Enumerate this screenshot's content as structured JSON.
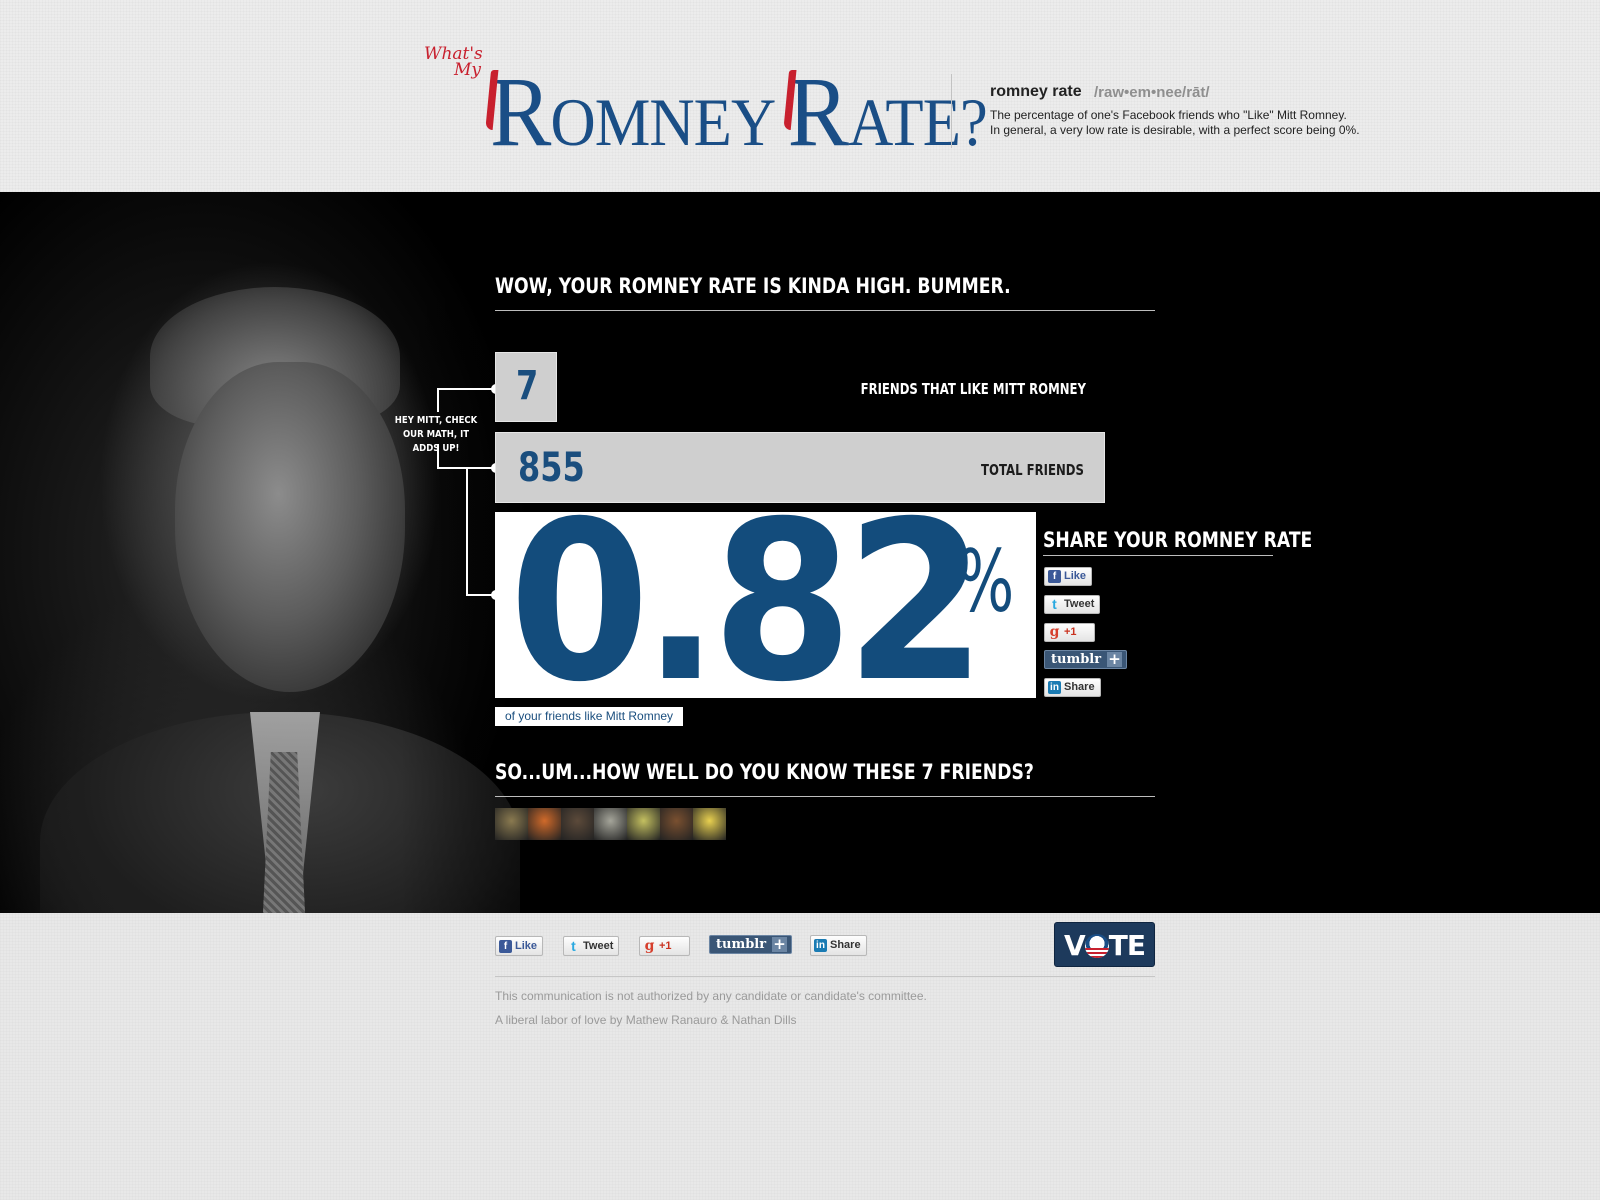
{
  "header": {
    "logo_whats": "What's",
    "logo_my": "My",
    "logo_r1": "R",
    "logo_word1": "OMNEY",
    "logo_r2": "R",
    "logo_word2": "ATE?",
    "definition_term": "romney rate",
    "definition_pronunciation": "/raw•em•nee/rāt/",
    "definition_line1": "The percentage of one's Facebook friends who \"Like\" Mitt Romney.",
    "definition_line2": "In general, a very low rate is desirable, with a perfect score being 0%."
  },
  "result": {
    "headline": "WOW, YOUR ROMNEY RATE IS KINDA HIGH. BUMMER.",
    "liking_friends_count": "7",
    "liking_friends_label": "FRIENDS THAT LIKE MITT ROMNEY",
    "total_friends_count": "855",
    "total_friends_label": "TOTAL FRIENDS",
    "bracket_note": "HEY MITT, CHECK OUR MATH, IT ADDS UP!",
    "percent_value": "0.82",
    "percent_sign": "%",
    "percent_caption": "of your friends like Mitt Romney"
  },
  "share": {
    "title": "SHARE YOUR ROMNEY RATE",
    "like_label": "Like",
    "tweet_label": "Tweet",
    "plusone_label": "+1",
    "tumblr_label": "tumblr",
    "tumblr_plus": "+",
    "linkedin_label": "Share"
  },
  "friends": {
    "title": "SO...UM...HOW WELL DO YOU KNOW THESE 7 FRIENDS?",
    "thumb_colors": [
      "#8a7a50",
      "#d06a2a",
      "#5c4a3a",
      "#a5a59a",
      "#c4c060",
      "#7a5030",
      "#e8d050"
    ]
  },
  "footer": {
    "like_label": "Like",
    "tweet_label": "Tweet",
    "plusone_label": "+1",
    "tumblr_label": "tumblr",
    "tumblr_plus": "+",
    "linkedin_label": "Share",
    "vote_prefix": "V",
    "vote_suffix": "TE",
    "disclaimer": "This communication is not authorized by any candidate or candidate's committee.",
    "credit": "A liberal labor of love by Mathew Ranauro & Nathan Dills"
  },
  "icons": {
    "facebook": "f",
    "twitter": "t",
    "google": "g",
    "linkedin": "in"
  },
  "colors": {
    "brand_blue": "#1a4e86",
    "brand_red": "#c8202e",
    "number_blue": "#134c7c"
  }
}
